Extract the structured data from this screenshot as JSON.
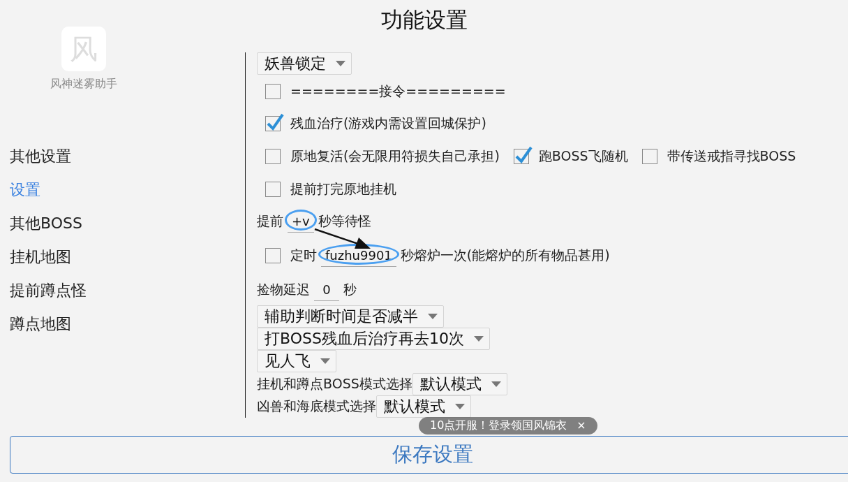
{
  "title": "功能设置",
  "app_icon": {
    "glyph": "风",
    "label": "风神迷雾助手"
  },
  "sidebar": {
    "items": [
      {
        "label": "其他设置",
        "selected": false
      },
      {
        "label": "设置",
        "selected": true
      },
      {
        "label": "其他BOSS",
        "selected": false
      },
      {
        "label": "挂机地图",
        "selected": false
      },
      {
        "label": "提前蹲点怪",
        "selected": false
      },
      {
        "label": "蹲点地图",
        "selected": false
      }
    ]
  },
  "settings": [
    {
      "kind": "select",
      "value": "妖兽锁定"
    },
    {
      "kind": "checkbox",
      "items": [
        {
          "label": "========接令=========",
          "checked": false
        }
      ]
    },
    {
      "kind": "checkbox",
      "items": [
        {
          "label": "残血治疗(游戏内需设置回城保护)",
          "checked": true
        }
      ]
    },
    {
      "kind": "checkbox",
      "items": [
        {
          "label": "原地复活(会无限用符损失自己承担)",
          "checked": false
        },
        {
          "label": "跑BOSS飞随机",
          "checked": true
        },
        {
          "label": "带传送戒指寻找BOSS",
          "checked": false
        }
      ]
    },
    {
      "kind": "checkbox",
      "items": [
        {
          "label": "提前打完原地挂机",
          "checked": false
        }
      ]
    },
    {
      "kind": "input",
      "prefix": "提前",
      "value": "+v",
      "suffix": "秒等待怪",
      "circled": true
    },
    {
      "kind": "input",
      "checked": false,
      "prefix": "定时",
      "value": "fuzhu9901",
      "suffix": "秒熔炉一次(能熔炉的所有物品甚用)",
      "circled": true
    },
    {
      "kind": "input",
      "prefix": "捡物延迟",
      "value": "0",
      "suffix": "秒",
      "circled": false
    },
    {
      "kind": "select",
      "value": "辅助判断时间是否减半"
    },
    {
      "kind": "select",
      "value": "打BOSS残血后治疗再去10次"
    },
    {
      "kind": "select",
      "value": "见人飞"
    },
    {
      "kind": "select",
      "prefix": "挂机和蹲点BOSS模式选择",
      "value": "默认模式"
    },
    {
      "kind": "select",
      "prefix": "凶兽和海底模式选择",
      "value": "默认模式"
    }
  ],
  "toast": {
    "text": "10点开服！登录领国风锦衣",
    "close": "×"
  },
  "save_button": "保存设置"
}
